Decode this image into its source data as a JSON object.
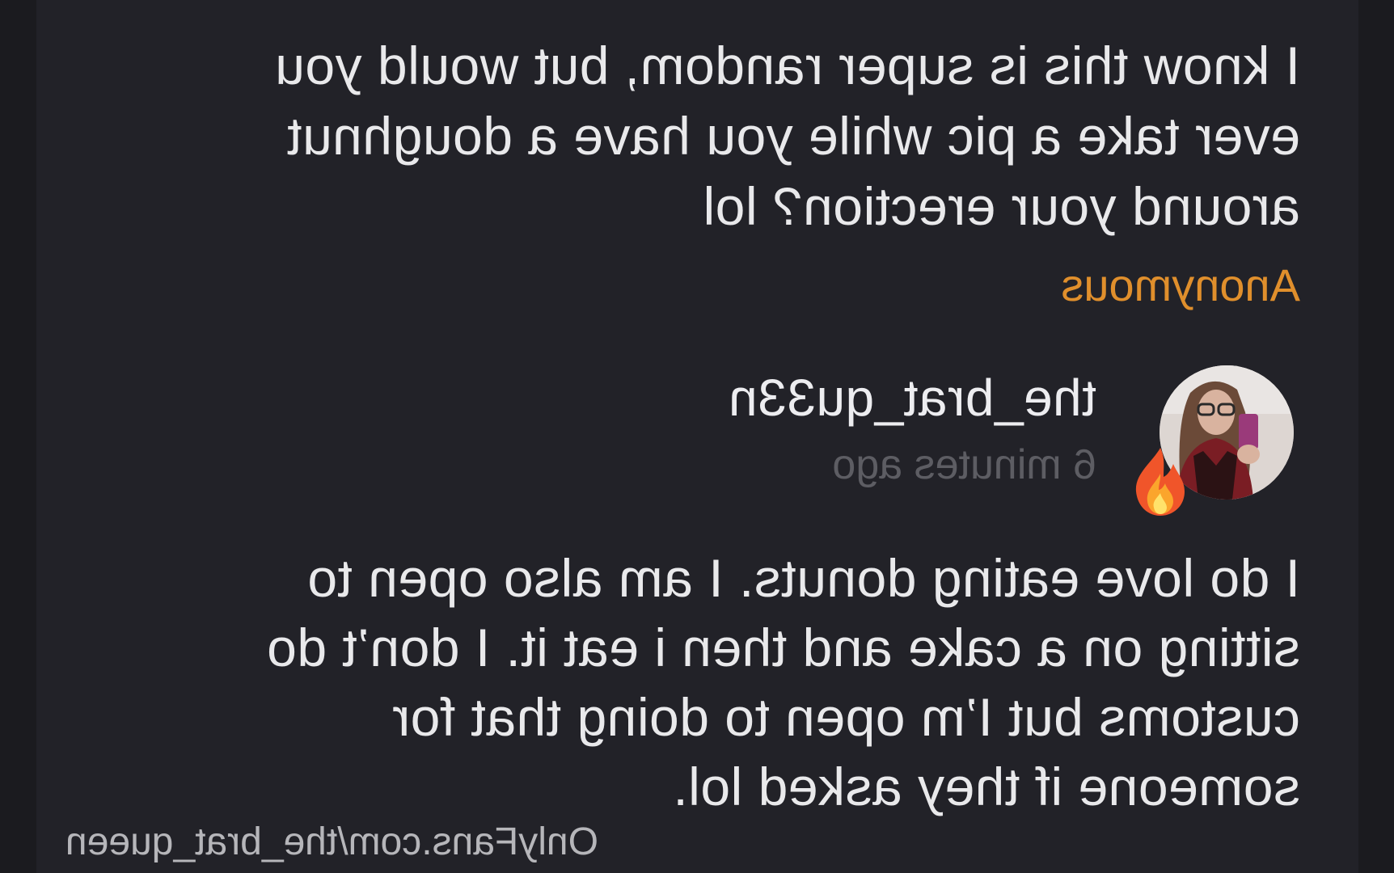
{
  "question": {
    "lines": [
      "I know this is super random, but would you",
      "ever take a pic while you have a doughnut",
      "around your erection? lol"
    ]
  },
  "asker": {
    "name": "Anonymous",
    "color": "#e08f2c"
  },
  "responder": {
    "username": "the_brat_qu33n",
    "timestamp": "6 minutes ago",
    "avatar_icon": "profile-photo",
    "badge_icon": "fire-emoji"
  },
  "answer": {
    "lines": [
      "I do love eating donuts. I am also open to",
      "sitting on a cake and then i eat it. I don’t do",
      "customs but I’m open to doing that for",
      "someone if they asked lol."
    ]
  },
  "watermark": {
    "text": "OnlyFans.com/the_brat_queen"
  },
  "colors": {
    "background": "#1b1b1f",
    "card": "#222228",
    "text": "#e9e9eb",
    "muted": "#5d5d63",
    "accent": "#e08f2c"
  }
}
